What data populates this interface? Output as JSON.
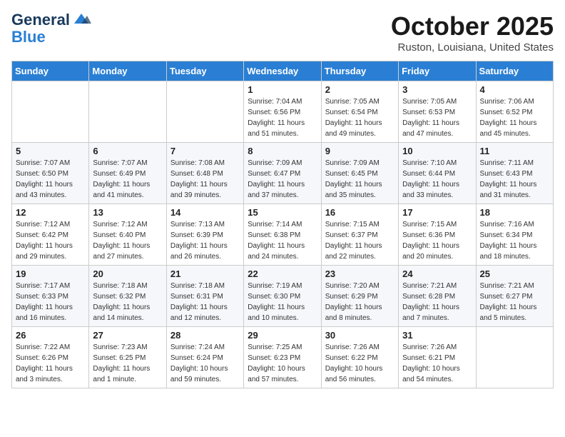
{
  "header": {
    "logo_general": "General",
    "logo_blue": "Blue",
    "month": "October 2025",
    "location": "Ruston, Louisiana, United States"
  },
  "weekdays": [
    "Sunday",
    "Monday",
    "Tuesday",
    "Wednesday",
    "Thursday",
    "Friday",
    "Saturday"
  ],
  "weeks": [
    [
      null,
      null,
      null,
      {
        "day": "1",
        "sunrise": "Sunrise: 7:04 AM",
        "sunset": "Sunset: 6:56 PM",
        "daylight": "Daylight: 11 hours and 51 minutes."
      },
      {
        "day": "2",
        "sunrise": "Sunrise: 7:05 AM",
        "sunset": "Sunset: 6:54 PM",
        "daylight": "Daylight: 11 hours and 49 minutes."
      },
      {
        "day": "3",
        "sunrise": "Sunrise: 7:05 AM",
        "sunset": "Sunset: 6:53 PM",
        "daylight": "Daylight: 11 hours and 47 minutes."
      },
      {
        "day": "4",
        "sunrise": "Sunrise: 7:06 AM",
        "sunset": "Sunset: 6:52 PM",
        "daylight": "Daylight: 11 hours and 45 minutes."
      }
    ],
    [
      {
        "day": "5",
        "sunrise": "Sunrise: 7:07 AM",
        "sunset": "Sunset: 6:50 PM",
        "daylight": "Daylight: 11 hours and 43 minutes."
      },
      {
        "day": "6",
        "sunrise": "Sunrise: 7:07 AM",
        "sunset": "Sunset: 6:49 PM",
        "daylight": "Daylight: 11 hours and 41 minutes."
      },
      {
        "day": "7",
        "sunrise": "Sunrise: 7:08 AM",
        "sunset": "Sunset: 6:48 PM",
        "daylight": "Daylight: 11 hours and 39 minutes."
      },
      {
        "day": "8",
        "sunrise": "Sunrise: 7:09 AM",
        "sunset": "Sunset: 6:47 PM",
        "daylight": "Daylight: 11 hours and 37 minutes."
      },
      {
        "day": "9",
        "sunrise": "Sunrise: 7:09 AM",
        "sunset": "Sunset: 6:45 PM",
        "daylight": "Daylight: 11 hours and 35 minutes."
      },
      {
        "day": "10",
        "sunrise": "Sunrise: 7:10 AM",
        "sunset": "Sunset: 6:44 PM",
        "daylight": "Daylight: 11 hours and 33 minutes."
      },
      {
        "day": "11",
        "sunrise": "Sunrise: 7:11 AM",
        "sunset": "Sunset: 6:43 PM",
        "daylight": "Daylight: 11 hours and 31 minutes."
      }
    ],
    [
      {
        "day": "12",
        "sunrise": "Sunrise: 7:12 AM",
        "sunset": "Sunset: 6:42 PM",
        "daylight": "Daylight: 11 hours and 29 minutes."
      },
      {
        "day": "13",
        "sunrise": "Sunrise: 7:12 AM",
        "sunset": "Sunset: 6:40 PM",
        "daylight": "Daylight: 11 hours and 27 minutes."
      },
      {
        "day": "14",
        "sunrise": "Sunrise: 7:13 AM",
        "sunset": "Sunset: 6:39 PM",
        "daylight": "Daylight: 11 hours and 26 minutes."
      },
      {
        "day": "15",
        "sunrise": "Sunrise: 7:14 AM",
        "sunset": "Sunset: 6:38 PM",
        "daylight": "Daylight: 11 hours and 24 minutes."
      },
      {
        "day": "16",
        "sunrise": "Sunrise: 7:15 AM",
        "sunset": "Sunset: 6:37 PM",
        "daylight": "Daylight: 11 hours and 22 minutes."
      },
      {
        "day": "17",
        "sunrise": "Sunrise: 7:15 AM",
        "sunset": "Sunset: 6:36 PM",
        "daylight": "Daylight: 11 hours and 20 minutes."
      },
      {
        "day": "18",
        "sunrise": "Sunrise: 7:16 AM",
        "sunset": "Sunset: 6:34 PM",
        "daylight": "Daylight: 11 hours and 18 minutes."
      }
    ],
    [
      {
        "day": "19",
        "sunrise": "Sunrise: 7:17 AM",
        "sunset": "Sunset: 6:33 PM",
        "daylight": "Daylight: 11 hours and 16 minutes."
      },
      {
        "day": "20",
        "sunrise": "Sunrise: 7:18 AM",
        "sunset": "Sunset: 6:32 PM",
        "daylight": "Daylight: 11 hours and 14 minutes."
      },
      {
        "day": "21",
        "sunrise": "Sunrise: 7:18 AM",
        "sunset": "Sunset: 6:31 PM",
        "daylight": "Daylight: 11 hours and 12 minutes."
      },
      {
        "day": "22",
        "sunrise": "Sunrise: 7:19 AM",
        "sunset": "Sunset: 6:30 PM",
        "daylight": "Daylight: 11 hours and 10 minutes."
      },
      {
        "day": "23",
        "sunrise": "Sunrise: 7:20 AM",
        "sunset": "Sunset: 6:29 PM",
        "daylight": "Daylight: 11 hours and 8 minutes."
      },
      {
        "day": "24",
        "sunrise": "Sunrise: 7:21 AM",
        "sunset": "Sunset: 6:28 PM",
        "daylight": "Daylight: 11 hours and 7 minutes."
      },
      {
        "day": "25",
        "sunrise": "Sunrise: 7:21 AM",
        "sunset": "Sunset: 6:27 PM",
        "daylight": "Daylight: 11 hours and 5 minutes."
      }
    ],
    [
      {
        "day": "26",
        "sunrise": "Sunrise: 7:22 AM",
        "sunset": "Sunset: 6:26 PM",
        "daylight": "Daylight: 11 hours and 3 minutes."
      },
      {
        "day": "27",
        "sunrise": "Sunrise: 7:23 AM",
        "sunset": "Sunset: 6:25 PM",
        "daylight": "Daylight: 11 hours and 1 minute."
      },
      {
        "day": "28",
        "sunrise": "Sunrise: 7:24 AM",
        "sunset": "Sunset: 6:24 PM",
        "daylight": "Daylight: 10 hours and 59 minutes."
      },
      {
        "day": "29",
        "sunrise": "Sunrise: 7:25 AM",
        "sunset": "Sunset: 6:23 PM",
        "daylight": "Daylight: 10 hours and 57 minutes."
      },
      {
        "day": "30",
        "sunrise": "Sunrise: 7:26 AM",
        "sunset": "Sunset: 6:22 PM",
        "daylight": "Daylight: 10 hours and 56 minutes."
      },
      {
        "day": "31",
        "sunrise": "Sunrise: 7:26 AM",
        "sunset": "Sunset: 6:21 PM",
        "daylight": "Daylight: 10 hours and 54 minutes."
      },
      null
    ]
  ]
}
